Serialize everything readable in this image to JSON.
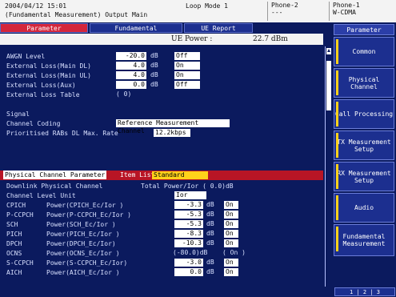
{
  "header": {
    "timestamp": "2004/04/12 15:01",
    "path": "(Fundamental Measurement) Output Main",
    "mode": "Loop Mode 1",
    "phone2_title": "Phone-2",
    "phone2_value": "---",
    "phone1_title": "Phone-1",
    "phone1_value": "W-CDMA"
  },
  "tabs": [
    {
      "label": "Parameter"
    },
    {
      "label": "Fundamental"
    },
    {
      "label": "UE Report"
    }
  ],
  "toolbar": {
    "ue_power_label": "UE Power :",
    "ue_power_value": "22.7 dBm"
  },
  "settings": {
    "awgn_label": "AWGN Level",
    "awgn_value": "-20.0",
    "awgn_unit": "dB",
    "awgn_state": "Off",
    "ext_dl_label": "External Loss(Main DL)",
    "ext_dl_value": "4.0",
    "ext_dl_unit": "dB",
    "ext_dl_state": "On",
    "ext_ul_label": "External Loss(Main UL)",
    "ext_ul_value": "4.0",
    "ext_ul_unit": "dB",
    "ext_ul_state": "On",
    "ext_aux_label": "External Loss(Aux)",
    "ext_aux_value": "0.0",
    "ext_aux_unit": "dB",
    "ext_aux_state": "Off",
    "ext_table_label": "External Loss Table",
    "ext_table_value": "( 0)"
  },
  "signal": {
    "section_label": "Signal",
    "coding_label": "Channel Coding",
    "coding_value": "Reference Measurement Channel",
    "rate_label": "Prioritised RABs DL Max. Rate",
    "rate_value": "12.2kbps"
  },
  "pcp": {
    "header_label": "Physical Channel Parameter",
    "item_list_label": "Item List",
    "item_list_value": "Standard",
    "downlink_label": "Downlink Physical Channel",
    "total_power_label": "Total Power/Ior ( 0.0)dB",
    "level_unit_label": "Channel Level Unit",
    "level_unit_value": "Ior",
    "rows": [
      {
        "name": "CPICH",
        "desc": "Power(CPICH_Ec/Ior     )",
        "value": "-3.3",
        "unit": "dB",
        "state": "On"
      },
      {
        "name": "P-CCPCH",
        "desc": "Power(P-CCPCH_Ec/Ior   )",
        "value": "-5.3",
        "unit": "dB",
        "state": "On"
      },
      {
        "name": "SCH",
        "desc": "Power(SCH_Ec/Ior     )",
        "value": "-5.3",
        "unit": "dB",
        "state": "On"
      },
      {
        "name": "PICH",
        "desc": "Power(PICH_Ec/Ior   )",
        "value": "-8.3",
        "unit": "dB",
        "state": "On"
      },
      {
        "name": "DPCH",
        "desc": "Power(DPCH_Ec/Ior)",
        "value": "-10.3",
        "unit": "dB",
        "state": "On"
      },
      {
        "name": "OCNS",
        "desc": "Power(OCNS_Ec/Ior     )",
        "value": "(-80.0)dB",
        "unit": "",
        "state": "( On )"
      },
      {
        "name": "S-CCPCH",
        "desc": "Power(S-CCPCH_Ec/Ior)",
        "value": "-3.0",
        "unit": "dB",
        "state": "On"
      },
      {
        "name": "AICH",
        "desc": "Power(AICH_Ec/Ior   )",
        "value": "0.0",
        "unit": "dB",
        "state": "On"
      }
    ]
  },
  "right_menu": {
    "title": "Parameter",
    "buttons": [
      {
        "label": "Common"
      },
      {
        "label": "Physical Channel"
      },
      {
        "label": "Call Processing"
      },
      {
        "label": "TX Measurement Setup"
      },
      {
        "label": "RX Measurement Setup"
      },
      {
        "label": "Audio"
      },
      {
        "label": "Fundamental Measurement"
      }
    ],
    "footer": "1 | 2 | 3"
  }
}
